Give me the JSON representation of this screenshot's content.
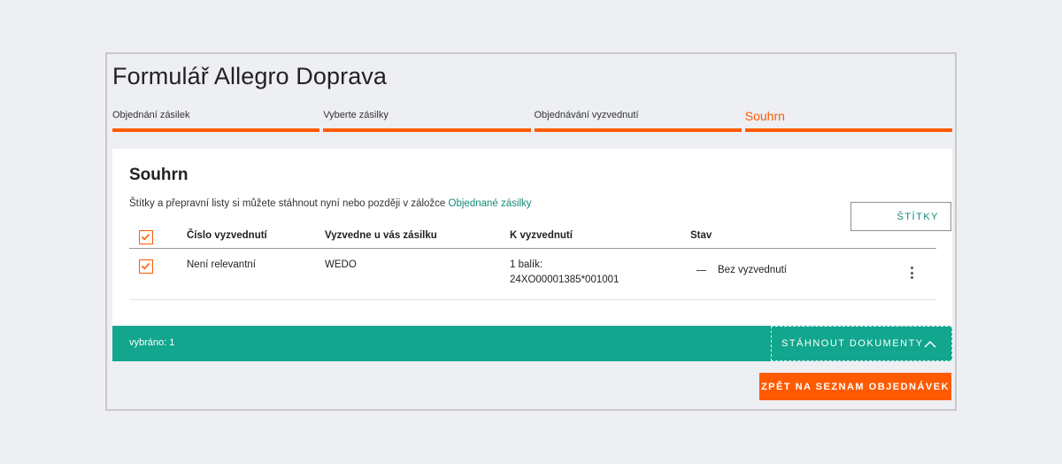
{
  "title": "Formulář Allegro Doprava",
  "steps": [
    {
      "label": "Objednání zásilek"
    },
    {
      "label": "Vyberte zásilky"
    },
    {
      "label": "Objednávání vyzvednutí"
    },
    {
      "label": "Souhrn"
    }
  ],
  "summary": {
    "heading": "Souhrn",
    "info_text": "Štítky a přepravní listy si můžete stáhnout nyní nebo později v záložce",
    "info_link": "Objednané zásilky"
  },
  "table": {
    "headers": {
      "pickup_number": "Číslo vyzvednutí",
      "picked_by": "Vyzvedne u vás zásilku",
      "to_pickup": "K vyzvednutí",
      "status": "Stav"
    },
    "rows": [
      {
        "pickup_number": "Není relevantní",
        "picked_by": "WEDO",
        "to_pickup_line1": "1 balík:",
        "to_pickup_line2": "24XO00001385*001001",
        "status": "Bez vyzvednutí"
      }
    ]
  },
  "buttons": {
    "labels": "ŠTÍTKY",
    "download": "STÁHNOUT DOKUMENTY",
    "back": "ZPĚT NA SEZNAM OBJEDNÁVEK"
  },
  "selection": {
    "count_text": "vybráno: 1"
  },
  "colors": {
    "accent": "#ff5a00",
    "teal": "#12a68e",
    "link": "#148a78"
  }
}
